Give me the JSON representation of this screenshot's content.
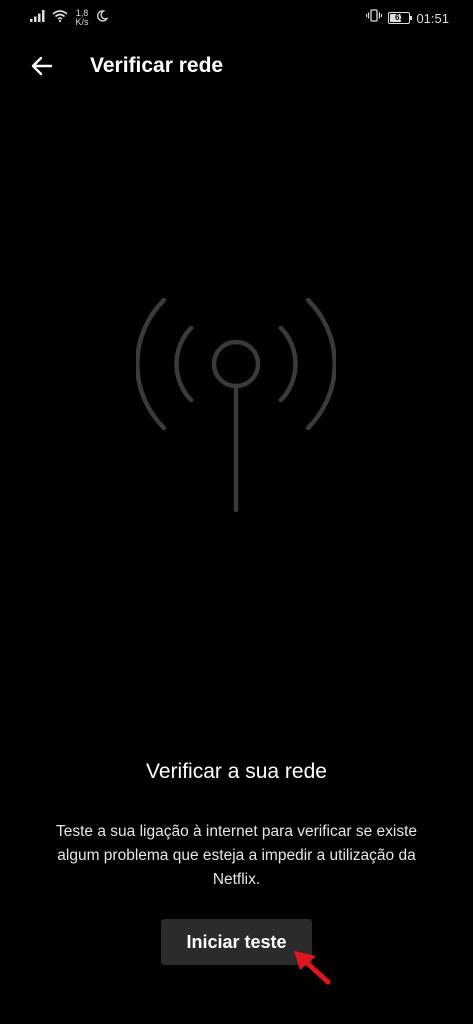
{
  "status_bar": {
    "net_speed_value": "1,8",
    "net_speed_unit": "K/s",
    "battery_level": "61",
    "battery_fraction": 0.61,
    "time": "01:51",
    "icons": [
      "signal-icon",
      "wifi-icon",
      "moon-icon",
      "vibrate-icon",
      "battery-icon"
    ]
  },
  "header": {
    "back_icon": "arrow-left-icon",
    "title": "Verificar rede"
  },
  "main": {
    "illustration_icon": "antenna-broadcast-icon",
    "heading": "Verificar a sua rede",
    "description": "Teste a sua ligação à internet para verificar se existe algum problema que esteja a impedir a utilização da Netflix.",
    "start_button_label": "Iniciar teste",
    "annotation_icon": "red-pointer-arrow-icon"
  },
  "colors": {
    "background": "#000000",
    "button_background": "#2b2b2b",
    "text": "#ffffff",
    "illustration": "#3a3a3a",
    "annotation_arrow": "#e0141e"
  }
}
